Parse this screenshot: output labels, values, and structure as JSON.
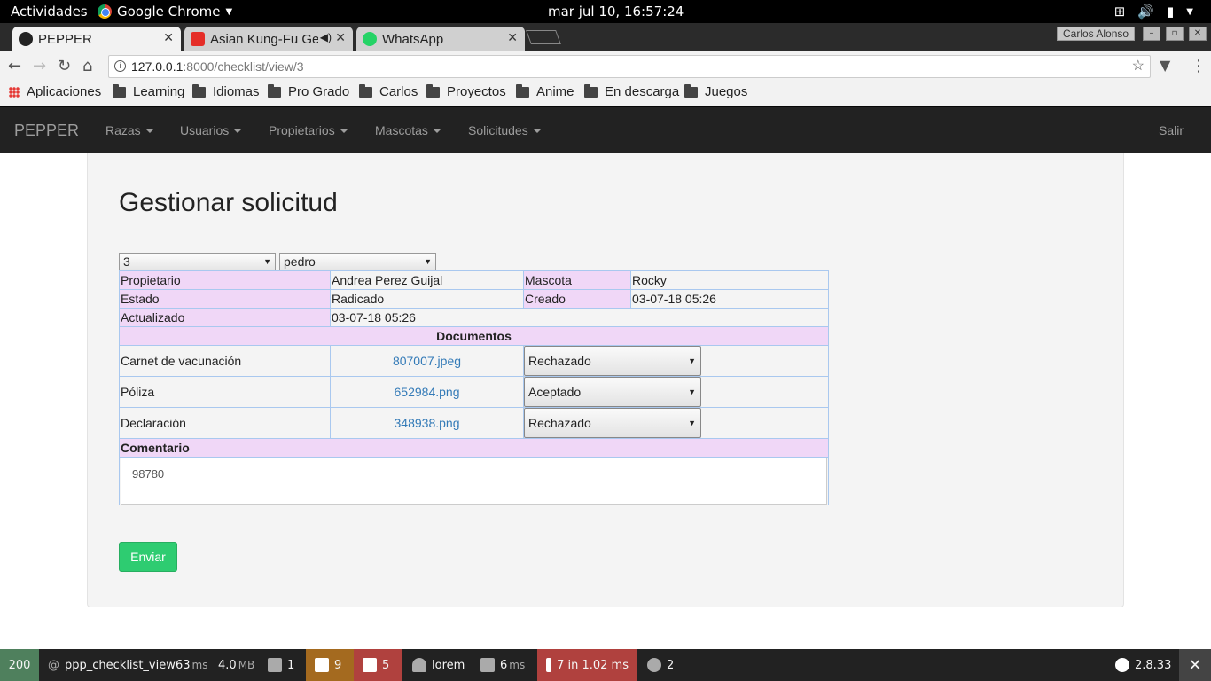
{
  "system": {
    "activities": "Actividades",
    "app_name": "Google Chrome",
    "clock": "mar jul 10, 16:57:24"
  },
  "browser": {
    "tabs": [
      {
        "label": "PEPPER",
        "active": true
      },
      {
        "label": "Asian Kung-Fu Ge",
        "active": false
      },
      {
        "label": "WhatsApp",
        "active": false
      }
    ],
    "profile": "Carlos Alonso",
    "url_host": "127.0.0.1",
    "url_path": ":8000/checklist/view/3",
    "bookmarks": [
      "Aplicaciones",
      "Learning",
      "Idiomas",
      "Pro Grado",
      "Carlos",
      "Proyectos",
      "Anime",
      "En descarga",
      "Juegos"
    ]
  },
  "navbar": {
    "brand": "PEPPER",
    "items": [
      "Razas",
      "Usuarios",
      "Propietarios",
      "Mascotas",
      "Solicitudes"
    ],
    "logout": "Salir"
  },
  "page": {
    "title": "Gestionar solicitud",
    "select_id": "3",
    "select_user": "pedro",
    "info": {
      "propietario_label": "Propietario",
      "propietario_value": "Andrea Perez Guijal",
      "mascota_label": "Mascota",
      "mascota_value": "Rocky",
      "estado_label": "Estado",
      "estado_value": "Radicado",
      "creado_label": "Creado",
      "creado_value": "03-07-18 05:26",
      "actualizado_label": "Actualizado",
      "actualizado_value": "03-07-18 05:26"
    },
    "documents_header": "Documentos",
    "documents": [
      {
        "name": "Carnet de vacunación",
        "file": "807007.jpeg",
        "status": "Rechazado"
      },
      {
        "name": "Póliza",
        "file": "652984.png",
        "status": "Aceptado"
      },
      {
        "name": "Declaración",
        "file": "348938.png",
        "status": "Rechazado"
      }
    ],
    "comment_header": "Comentario",
    "comment_value": "98780",
    "submit": "Enviar"
  },
  "debug_toolbar": {
    "status": "200",
    "route": "ppp_checklist_view",
    "time_value": "63",
    "time_unit": "ms",
    "memory_value": "4.0",
    "memory_unit": "MB",
    "forms": "1",
    "warnings": "9",
    "translations": "5",
    "user": "lorem",
    "twig_value": "6",
    "twig_unit": "ms",
    "db": "7 in 1.02 ms",
    "events": "2",
    "version": "2.8.33",
    "colors": {
      "status": "#4f805d",
      "warnings": "#a46a1f",
      "errors": "#b0413e"
    }
  }
}
